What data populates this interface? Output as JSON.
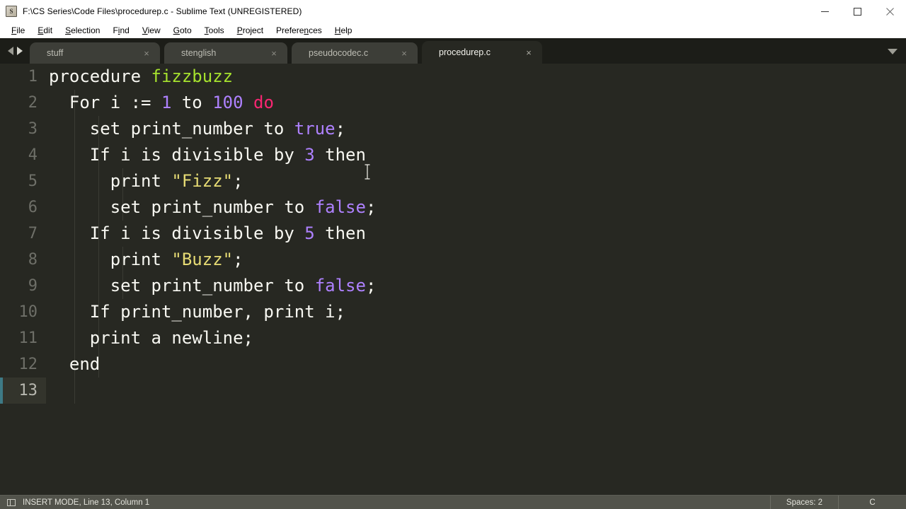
{
  "window": {
    "title": "F:\\CS Series\\Code Files\\procedurep.c - Sublime Text (UNREGISTERED)",
    "app_icon": "sublime-text-icon",
    "minimize_label": "–",
    "maximize_label": "□",
    "close_label": "×"
  },
  "menubar": {
    "items": [
      {
        "label": "File",
        "mnemonic": "F",
        "pre": "",
        "post": "ile"
      },
      {
        "label": "Edit",
        "mnemonic": "E",
        "pre": "",
        "post": "dit"
      },
      {
        "label": "Selection",
        "mnemonic": "S",
        "pre": "",
        "post": "election"
      },
      {
        "label": "Find",
        "mnemonic": "i",
        "pre": "F",
        "post": "nd"
      },
      {
        "label": "View",
        "mnemonic": "V",
        "pre": "",
        "post": "iew"
      },
      {
        "label": "Goto",
        "mnemonic": "G",
        "pre": "",
        "post": "oto"
      },
      {
        "label": "Tools",
        "mnemonic": "T",
        "pre": "",
        "post": "ools"
      },
      {
        "label": "Project",
        "mnemonic": "P",
        "pre": "",
        "post": "roject"
      },
      {
        "label": "Preferences",
        "mnemonic": "n",
        "pre": "Prefere",
        "post": "ces"
      },
      {
        "label": "Help",
        "mnemonic": "H",
        "pre": "",
        "post": "elp"
      }
    ]
  },
  "tabbar": {
    "prev_label": "◀",
    "next_label": "▶",
    "close_label": "×",
    "overflow_label": "▼",
    "tabs": [
      {
        "label": "stuff",
        "active": false
      },
      {
        "label": "stenglish",
        "active": false
      },
      {
        "label": "pseudocodec.c",
        "active": false
      },
      {
        "label": "procedurep.c",
        "active": true
      }
    ]
  },
  "editor": {
    "current_line": 13,
    "line_numbers": [
      "1",
      "2",
      "3",
      "4",
      "5",
      "6",
      "7",
      "8",
      "9",
      "10",
      "11",
      "12",
      "13"
    ],
    "lines": [
      {
        "n": "1",
        "text": "procedure fizzbuzz"
      },
      {
        "n": "2",
        "text": "  For i := 1 to 100 do"
      },
      {
        "n": "3",
        "text": "    set print_number to true;"
      },
      {
        "n": "4",
        "text": "    If i is divisible by 3 then"
      },
      {
        "n": "5",
        "text": "      print \"Fizz\";"
      },
      {
        "n": "6",
        "text": "      set print_number to false;"
      },
      {
        "n": "7",
        "text": "    If i is divisible by 5 then"
      },
      {
        "n": "8",
        "text": "      print \"Buzz\";"
      },
      {
        "n": "9",
        "text": "      set print_number to false;"
      },
      {
        "n": "10",
        "text": "    If print_number, print i;"
      },
      {
        "n": "11",
        "text": "    print a newline;"
      },
      {
        "n": "12",
        "text": "  end"
      },
      {
        "n": "13",
        "text": ""
      }
    ],
    "tokens": {
      "l1_a": "procedure ",
      "l1_fn": "fizzbuzz",
      "l2_a": "  For i := ",
      "l2_n1": "1",
      "l2_b": " to ",
      "l2_n2": "100",
      "l2_c": " ",
      "l2_kw": "do",
      "l3_a": "    set print_number to ",
      "l3_cst": "true",
      "l3_b": ";",
      "l4_a": "    If i is divisible by ",
      "l4_n": "3",
      "l4_b": " then",
      "l5_a": "      print ",
      "l5_str": "\"Fizz\"",
      "l5_b": ";",
      "l6_a": "      set print_number to ",
      "l6_cst": "false",
      "l6_b": ";",
      "l7_a": "    If i is divisible by ",
      "l7_n": "5",
      "l7_b": " then",
      "l8_a": "      print ",
      "l8_str": "\"Buzz\"",
      "l8_b": ";",
      "l9_a": "      set print_number to ",
      "l9_cst": "false",
      "l9_b": ";",
      "l10": "    If print_number, print i;",
      "l11": "    print a newline;",
      "l12": "  end"
    },
    "colors": {
      "background": "#272822",
      "foreground": "#f8f8f2",
      "function": "#a6e22e",
      "number": "#ae81ff",
      "keyword": "#f92672",
      "string": "#e6db74",
      "constant": "#ae81ff",
      "gutter_text": "#6e6f68",
      "current_line_gutter": "#33342c",
      "current_line_accent": "#3e7a86"
    }
  },
  "statusbar": {
    "sidebar_icon": "sidebar-toggle-icon",
    "left_text": "INSERT MODE, Line 13, Column 1",
    "indentation": "Spaces: 2",
    "syntax": "C"
  }
}
